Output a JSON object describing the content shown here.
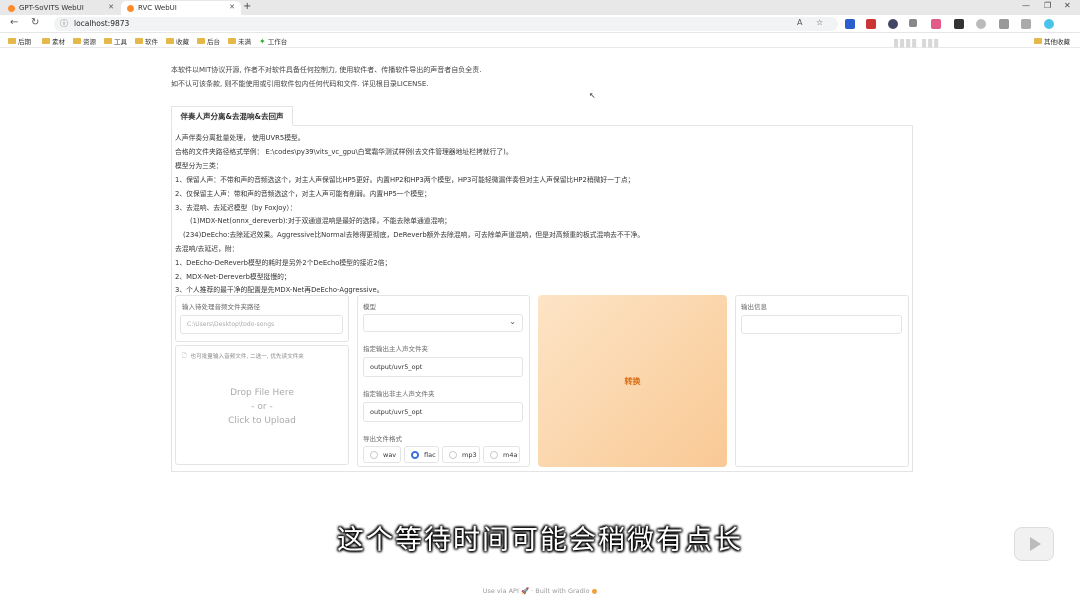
{
  "browser": {
    "tabs": [
      {
        "title": "GPT-SoVITS WebUI",
        "active": false
      },
      {
        "title": "RVC WebUI",
        "active": true
      }
    ],
    "url": "localhost:9873",
    "bookmarks": [
      "后期",
      "素材",
      "资源",
      "工具",
      "软件",
      "收藏",
      "后台",
      "未满",
      "工作台"
    ],
    "other_bookmarks": "其他收藏"
  },
  "notice": {
    "line1": "本软件以MIT协议开源, 作者不对软件具备任何控制力, 使用软件者、传播软件导出的声音者自负全责.",
    "line2": "如不认可该条款, 则不能使用或引用软件包内任何代码和文件. 详见根目录LICENSE."
  },
  "tab": {
    "label": "伴奏人声分离&去混响&去回声"
  },
  "description": [
    "人声伴奏分离批量处理， 使用UVR5模型。",
    "合格的文件夹路径格式举例： E:\\codes\\py39\\vits_vc_gpu\\白鹭霜华测试样例(去文件管理器地址栏拷就行了)。",
    "模型分为三类：",
    "1、保留人声：不带和声的音频选这个，对主人声保留比HP5更好。内置HP2和HP3两个模型，HP3可能轻微漏伴奏但对主人声保留比HP2稍微好一丁点；",
    "2、仅保留主人声：带和声的音频选这个，对主人声可能有削弱。内置HP5一个模型；",
    "3、去混响、去延迟模型（by FoxJoy）：",
    "(1)MDX-Net(onnx_dereverb):对于双通道混响是最好的选择，不能去除单通道混响；",
    "(234)DeEcho:去除延迟效果。Aggressive比Normal去除得更彻底，DeReverb额外去除混响，可去除单声道混响，但是对高频重的板式混响去不干净。",
    "去混响/去延迟，附：",
    "1、DeEcho-DeReverb模型的耗时是另外2个DeEcho模型的接近2倍；",
    "2、MDX-Net-Dereverb模型挺慢的；",
    "3、个人推荐的最干净的配置是先MDX-Net再DeEcho-Aggressive。"
  ],
  "input_panel": {
    "label": "输入待处理音频文件夹路径",
    "placeholder": "C:\\Users\\Desktop\\todo-songs",
    "upload_hint": "也可批量输入音频文件, 二选一, 优先读文件夹",
    "drop_line1": "Drop File Here",
    "drop_line2": "- or -",
    "drop_line3": "Click to Upload"
  },
  "model_panel": {
    "model_label": "模型",
    "model_value": "",
    "vocal_label": "指定输出主人声文件夹",
    "vocal_value": "output/uvr5_opt",
    "other_label": "指定输出非主人声文件夹",
    "other_value": "output/uvr5_opt",
    "format_label": "导出文件格式",
    "formats": [
      "wav",
      "flac",
      "mp3",
      "m4a"
    ],
    "selected_format": "flac"
  },
  "convert_button": "转换",
  "output_panel": {
    "label": "输出信息",
    "value": ""
  },
  "subtitle": "这个等待时间可能会稍微有点长",
  "footer": {
    "api": "Use via API",
    "sep": "·",
    "built": "Built with Gradio"
  },
  "colors": {
    "accent": "#3b6fe0",
    "convert_text": "#d86b10",
    "convert_bg": "#fbd7ad"
  }
}
